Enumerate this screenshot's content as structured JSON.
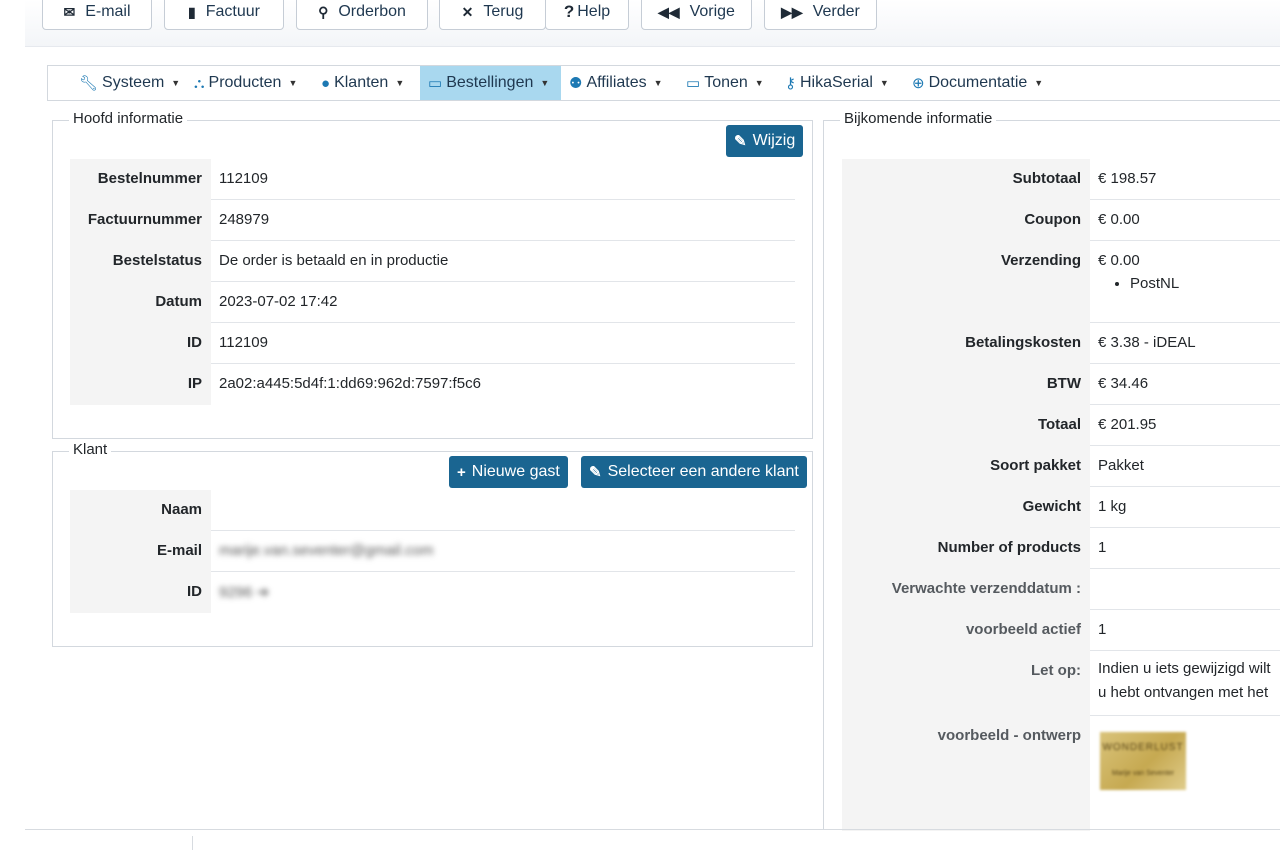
{
  "toolbar": {
    "email": "E-mail",
    "invoice": "Factuur",
    "orderslip": "Orderbon",
    "back": "Terug",
    "help": "Help",
    "prev": "Vorige",
    "next": "Verder"
  },
  "menu": {
    "items": [
      {
        "label": "Systeem",
        "icon": "wrench-icon"
      },
      {
        "label": "Producten",
        "icon": "cubes-icon"
      },
      {
        "label": "Klanten",
        "icon": "user-icon"
      },
      {
        "label": "Bestellingen",
        "icon": "credit-card-icon",
        "active": true
      },
      {
        "label": "Affiliates",
        "icon": "users-icon"
      },
      {
        "label": "Tonen",
        "icon": "monitor-icon"
      },
      {
        "label": "HikaSerial",
        "icon": "key-icon"
      },
      {
        "label": "Documentatie",
        "icon": "lifebuoy-icon"
      }
    ]
  },
  "main_info": {
    "legend": "Hoofd informatie",
    "edit_button": "Wijzig",
    "rows": [
      {
        "label": "Bestelnummer",
        "value": "112109"
      },
      {
        "label": "Factuurnummer",
        "value": "248979"
      },
      {
        "label": "Bestelstatus",
        "value": "De order is betaald en in productie"
      },
      {
        "label": "Datum",
        "value": "2023-07-02 17:42"
      },
      {
        "label": "ID",
        "value": "112109"
      },
      {
        "label": "IP",
        "value": "2a02:a445:5d4f:1:dd69:962d:7597:f5c6"
      }
    ]
  },
  "customer": {
    "legend": "Klant",
    "new_guest_button": "Nieuwe gast",
    "select_button": "Selecteer een andere klant",
    "rows": [
      {
        "label": "Naam",
        "value": ""
      },
      {
        "label": "E-mail",
        "value": "marije.van.seventer@gmail.com"
      },
      {
        "label": "ID",
        "value": "9296 ➔"
      }
    ]
  },
  "additional": {
    "legend": "Bijkomende informatie",
    "rows": [
      {
        "label": "Subtotaal",
        "value": "€ 198.57"
      },
      {
        "label": "Coupon",
        "value": "€ 0.00"
      },
      {
        "label": "Verzending",
        "value": "€ 0.00",
        "sub": "PostNL"
      },
      {
        "label": "Betalingskosten",
        "value": "€ 3.38 - iDEAL"
      },
      {
        "label": "BTW",
        "value": "€ 34.46"
      },
      {
        "label": "Totaal",
        "value": "€ 201.95"
      },
      {
        "label": "Soort pakket",
        "value": "Pakket"
      },
      {
        "label": "Gewicht",
        "value": "1 kg"
      },
      {
        "label": "Number of products",
        "value": "1"
      },
      {
        "label": "Verwachte verzenddatum :",
        "value": ""
      },
      {
        "label": "voorbeeld actief",
        "value": "1"
      },
      {
        "label": "Let op:",
        "value": "Indien u iets gewijzigd wilt",
        "value2": "u hebt ontvangen met het"
      },
      {
        "label": "voorbeeld - ontwerp",
        "value": ""
      }
    ],
    "thumbnail": {
      "title": "WONDERLUST",
      "caption": "Marije van Seventer"
    }
  }
}
